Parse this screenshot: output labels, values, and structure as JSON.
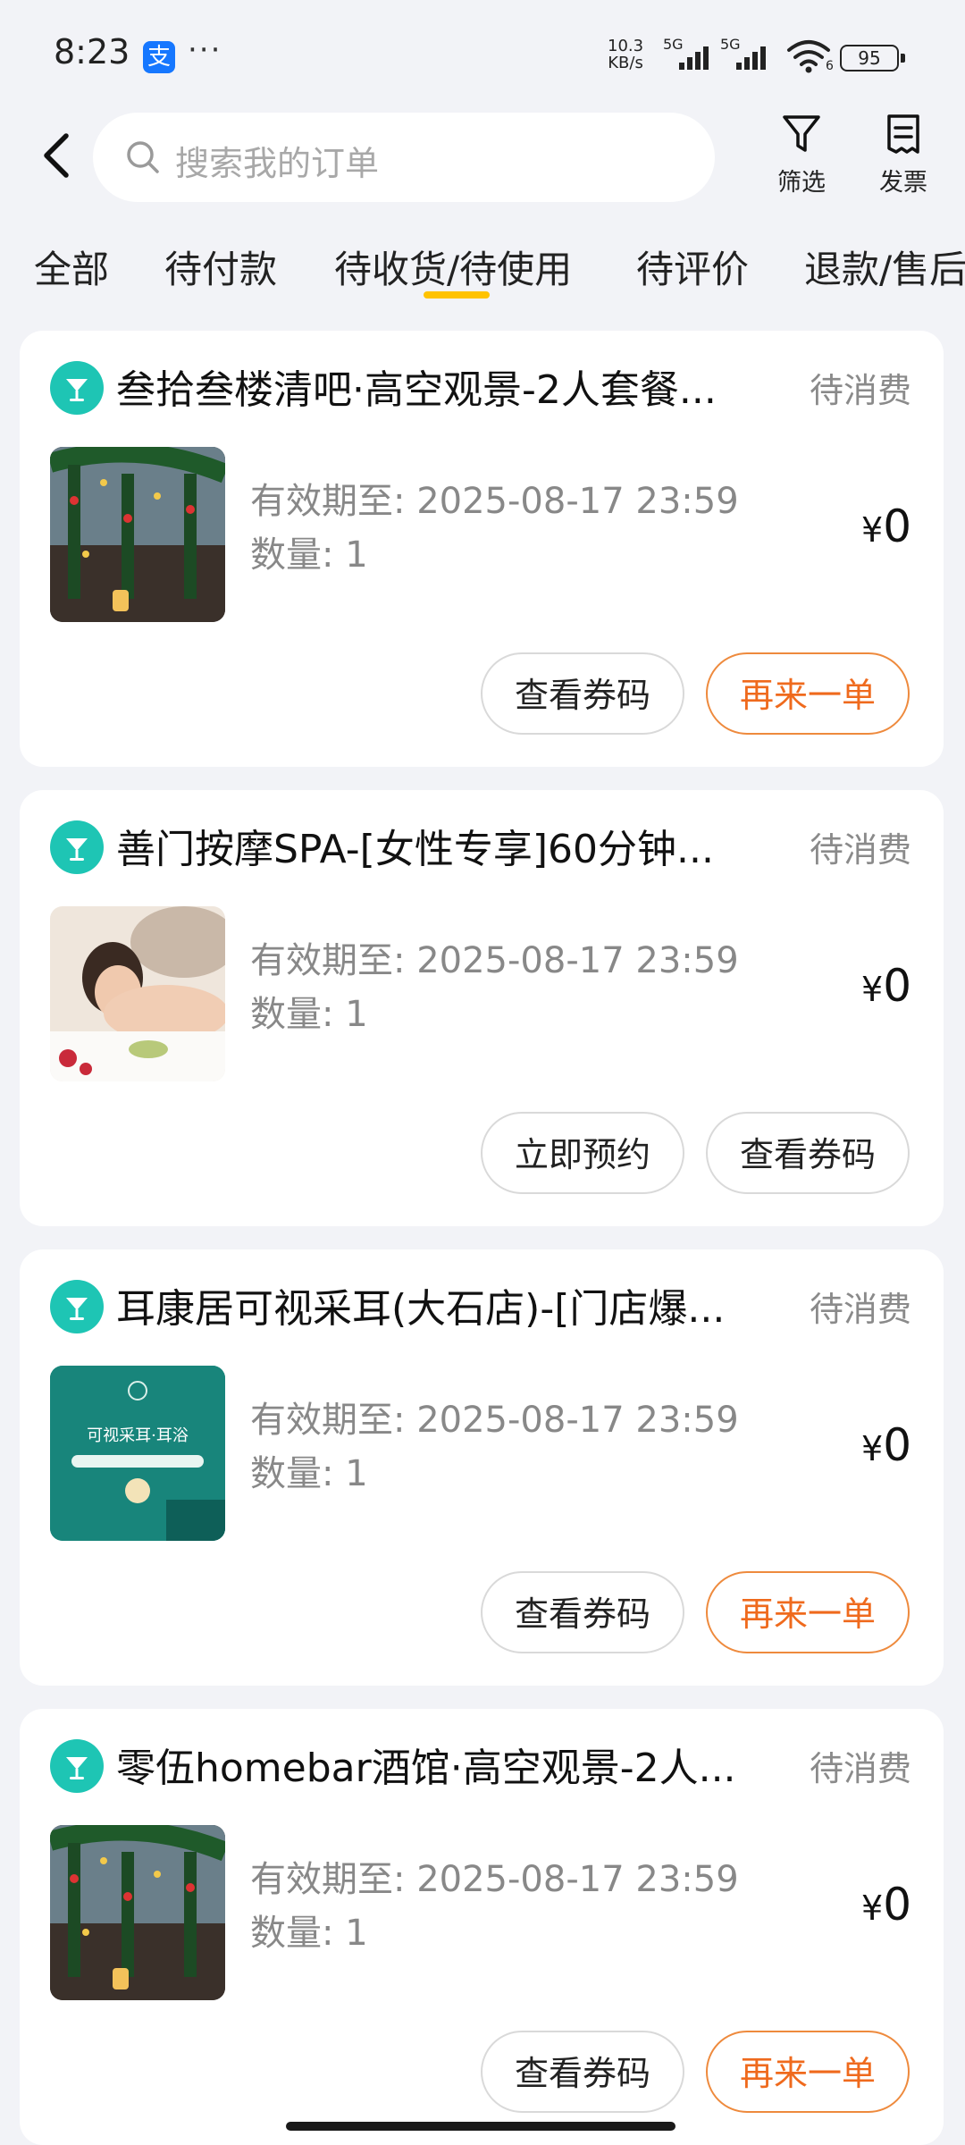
{
  "status_bar": {
    "time": "8:23",
    "alipay_icon_text": "支",
    "more_dots": "···",
    "net_speed_value": "10.3",
    "net_speed_unit": "KB/s",
    "sim1": "5G",
    "sim2": "5G",
    "wifi_label": "6",
    "battery": "95"
  },
  "header": {
    "search_placeholder": "搜索我的订单",
    "filter_label": "筛选",
    "invoice_label": "发票"
  },
  "tabs": [
    {
      "label": "全部"
    },
    {
      "label": "待付款"
    },
    {
      "label": "待收货/待使用"
    },
    {
      "label": "待评价"
    },
    {
      "label": "退款/售后"
    }
  ],
  "active_tab": "待收货/待使用",
  "orders": [
    {
      "title": "叁拾叁楼清吧·高空观景-2人套餐...",
      "status": "待消费",
      "validity": "有效期至: 2025-08-17 23:59",
      "quantity": "数量: 1",
      "price_symbol": "¥",
      "price": "0",
      "buttons": [
        "查看券码",
        "再来一单"
      ],
      "thumb": "bar-night-view"
    },
    {
      "title": "善门按摩SPA-[女性专享]60分钟...",
      "status": "待消费",
      "validity": "有效期至: 2025-08-17 23:59",
      "quantity": "数量: 1",
      "price_symbol": "¥",
      "price": "0",
      "buttons": [
        "立即预约",
        "查看券码"
      ],
      "thumb": "spa-massage"
    },
    {
      "title": "耳康居可视采耳(大石店)-[门店爆...",
      "status": "待消费",
      "validity": "有效期至: 2025-08-17 23:59",
      "quantity": "数量: 1",
      "price_symbol": "¥",
      "price": "0",
      "buttons": [
        "查看券码",
        "再来一单"
      ],
      "thumb": "ear-cleaning",
      "thumb_text": "可视采耳·耳浴"
    },
    {
      "title": "零伍homebar酒馆·高空观景-2人...",
      "status": "待消费",
      "validity": "有效期至: 2025-08-17 23:59",
      "quantity": "数量: 1",
      "price_symbol": "¥",
      "price": "0",
      "buttons": [
        "查看券码",
        "再来一单"
      ],
      "thumb": "bar-night-view"
    }
  ],
  "colors": {
    "accent_yellow": "#ffc300",
    "orange_button": "#ef6a1d",
    "mascot_teal": "#1ec5b4",
    "background": "#f2f3f7"
  }
}
